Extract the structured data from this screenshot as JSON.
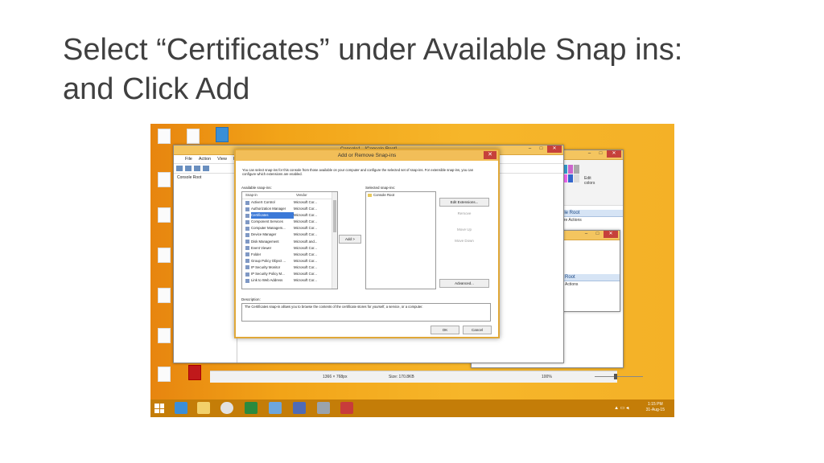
{
  "slide": {
    "title_line1": "Select “Certificates” under Available Snap ins:",
    "title_line2": "and Click Add"
  },
  "console": {
    "title": "Console1 - [Console Root]",
    "menu": [
      "File",
      "Action",
      "View",
      "F"
    ],
    "tree_root": "Console Root"
  },
  "paint": {
    "edit_colors": "Edit colors",
    "actions_header": "ole Root",
    "actions_more": "ore Actions",
    "actions_header_2": "Root",
    "actions_sub_2": "Actions"
  },
  "statusbar": {
    "dimensions": "1366 × 768px",
    "size": "Size: 170.8KB",
    "zoom": "100%"
  },
  "dialog": {
    "title": "Add or Remove Snap-ins",
    "intro": "You can select snap-ins for this console from those available on your computer and configure the selected set of snap-ins. For extensible snap-ins, you can configure which extensions are enabled.",
    "available_label": "Available snap-ins:",
    "selected_label": "Selected snap-ins:",
    "col_snapin": "Snap-in",
    "col_vendor": "Vendor",
    "snapins": [
      {
        "name": "ActiveX Control",
        "vendor": "Microsoft Cor..."
      },
      {
        "name": "Authorization Manager",
        "vendor": "Microsoft Cor..."
      },
      {
        "name": "Certificates",
        "vendor": "Microsoft Cor..."
      },
      {
        "name": "Component Services",
        "vendor": "Microsoft Cor..."
      },
      {
        "name": "Computer Managem...",
        "vendor": "Microsoft Cor..."
      },
      {
        "name": "Device Manager",
        "vendor": "Microsoft Cor..."
      },
      {
        "name": "Disk Management",
        "vendor": "Microsoft and..."
      },
      {
        "name": "Event Viewer",
        "vendor": "Microsoft Cor..."
      },
      {
        "name": "Folder",
        "vendor": "Microsoft Cor..."
      },
      {
        "name": "Group Policy Object ...",
        "vendor": "Microsoft Cor..."
      },
      {
        "name": "IP Security Monitor",
        "vendor": "Microsoft Cor..."
      },
      {
        "name": "IP Security Policy M...",
        "vendor": "Microsoft Cor..."
      },
      {
        "name": "Link to Web Address",
        "vendor": "Microsoft Cor..."
      }
    ],
    "selected_snapins": [
      "Console Root"
    ],
    "add_button": "Add >",
    "edit_extensions": "Edit Extensions...",
    "remove": "Remove",
    "move_up": "Move Up",
    "move_down": "Move Down",
    "advanced": "Advanced...",
    "description_label": "Description:",
    "description": "The Certificates snap-in allows you to browse the contents of the certificate stores for yourself, a service, or a computer.",
    "ok": "OK",
    "cancel": "Cancel"
  },
  "taskbar": {
    "time": "1:15 PM",
    "date": "31-Aug-15"
  },
  "colors": {
    "dialog_border": "#e0a838",
    "selected_row": "#3b79d8",
    "taskbar": "#c47d08"
  }
}
